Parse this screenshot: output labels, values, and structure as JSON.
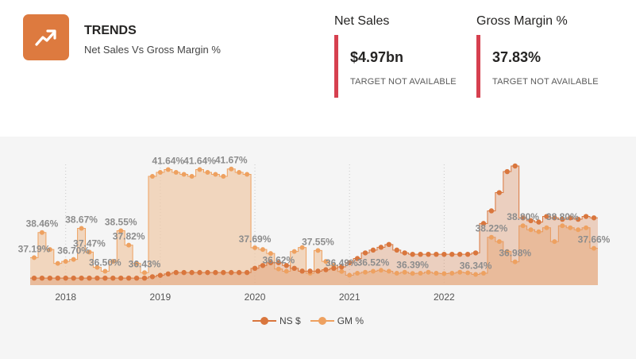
{
  "header": {
    "icon": "trending-up-icon",
    "title": "TRENDS",
    "subtitle": "Net Sales Vs Gross Margin %"
  },
  "kpis": [
    {
      "name": "Net Sales",
      "value": "$4.97bn",
      "target": "TARGET NOT AVAILABLE"
    },
    {
      "name": "Gross Margin %",
      "value": "37.83%",
      "target": "TARGET NOT AVAILABLE"
    }
  ],
  "colors": {
    "icon_bg": "#dd7a3f",
    "kpi_bar": "#d6404f",
    "ns_series": "#d9763d",
    "gm_series": "#eea160"
  },
  "chart_data": {
    "type": "area",
    "x_ticks": [
      "2018",
      "2019",
      "2020",
      "2021",
      "2022"
    ],
    "x_start": "2017-09",
    "legend": {
      "position": "bottom",
      "items": [
        "NS $",
        "GM %"
      ]
    },
    "grid": false,
    "series": [
      {
        "name": "GM %",
        "style": "step-area",
        "values": [
          37.19,
          38.46,
          37.6,
          36.9,
          37.0,
          37.1,
          38.67,
          37.47,
          36.7,
          36.5,
          37.0,
          38.55,
          37.82,
          36.9,
          36.43,
          41.3,
          41.5,
          41.64,
          41.5,
          41.4,
          41.3,
          41.64,
          41.5,
          41.4,
          41.3,
          41.67,
          41.5,
          41.4,
          37.69,
          37.6,
          37.4,
          36.62,
          36.5,
          37.5,
          37.7,
          36.4,
          37.55,
          37.0,
          36.8,
          36.49,
          36.3,
          36.4,
          36.45,
          36.5,
          36.55,
          36.5,
          36.4,
          36.45,
          36.39,
          36.4,
          36.45,
          36.4,
          36.38,
          36.4,
          36.45,
          36.42,
          36.34,
          36.4,
          38.22,
          38.0,
          37.5,
          36.98,
          38.8,
          38.6,
          38.5,
          38.7,
          38.0,
          38.8,
          38.7,
          38.6,
          38.7,
          37.66
        ],
        "labels": [
          {
            "i": 0,
            "text": "37.19%"
          },
          {
            "i": 1,
            "text": "38.46%"
          },
          {
            "i": 5,
            "text": "36.70%"
          },
          {
            "i": 6,
            "text": "38.67%"
          },
          {
            "i": 7,
            "text": "37.47%"
          },
          {
            "i": 9,
            "text": "36.50%"
          },
          {
            "i": 11,
            "text": "38.55%"
          },
          {
            "i": 12,
            "text": "37.82%"
          },
          {
            "i": 14,
            "text": "36.43%"
          },
          {
            "i": 17,
            "text": "41.64%"
          },
          {
            "i": 21,
            "text": "41.64%"
          },
          {
            "i": 25,
            "text": "41.67%"
          },
          {
            "i": 28,
            "text": "37.69%"
          },
          {
            "i": 31,
            "text": "36.62%"
          },
          {
            "i": 36,
            "text": "37.55%"
          },
          {
            "i": 39,
            "text": "36.49%"
          },
          {
            "i": 43,
            "text": "36.52%"
          },
          {
            "i": 48,
            "text": "36.39%"
          },
          {
            "i": 56,
            "text": "36.34%"
          },
          {
            "i": 58,
            "text": "38.22%"
          },
          {
            "i": 61,
            "text": "36.98%"
          },
          {
            "i": 62,
            "text": "38.80%"
          },
          {
            "i": 67,
            "text": "38.80%"
          },
          {
            "i": 71,
            "text": "37.66%"
          }
        ]
      },
      {
        "name": "NS $",
        "style": "step-area",
        "values": [
          0.5,
          0.5,
          0.5,
          0.5,
          0.5,
          0.5,
          0.5,
          0.5,
          0.5,
          0.5,
          0.5,
          0.5,
          0.5,
          0.5,
          0.5,
          0.6,
          0.7,
          0.8,
          0.9,
          0.9,
          0.9,
          0.9,
          0.9,
          0.9,
          0.9,
          0.9,
          0.9,
          0.9,
          1.2,
          1.4,
          1.6,
          1.6,
          1.4,
          1.2,
          1.0,
          1.0,
          1.0,
          1.1,
          1.2,
          1.3,
          1.6,
          1.9,
          2.3,
          2.5,
          2.7,
          2.9,
          2.5,
          2.3,
          2.2,
          2.2,
          2.2,
          2.2,
          2.2,
          2.2,
          2.2,
          2.2,
          2.3,
          4.4,
          5.3,
          6.6,
          8.1,
          8.5,
          4.8,
          4.6,
          4.5,
          4.9,
          4.8,
          4.7,
          4.8,
          4.7,
          4.9,
          4.8
        ]
      }
    ]
  }
}
